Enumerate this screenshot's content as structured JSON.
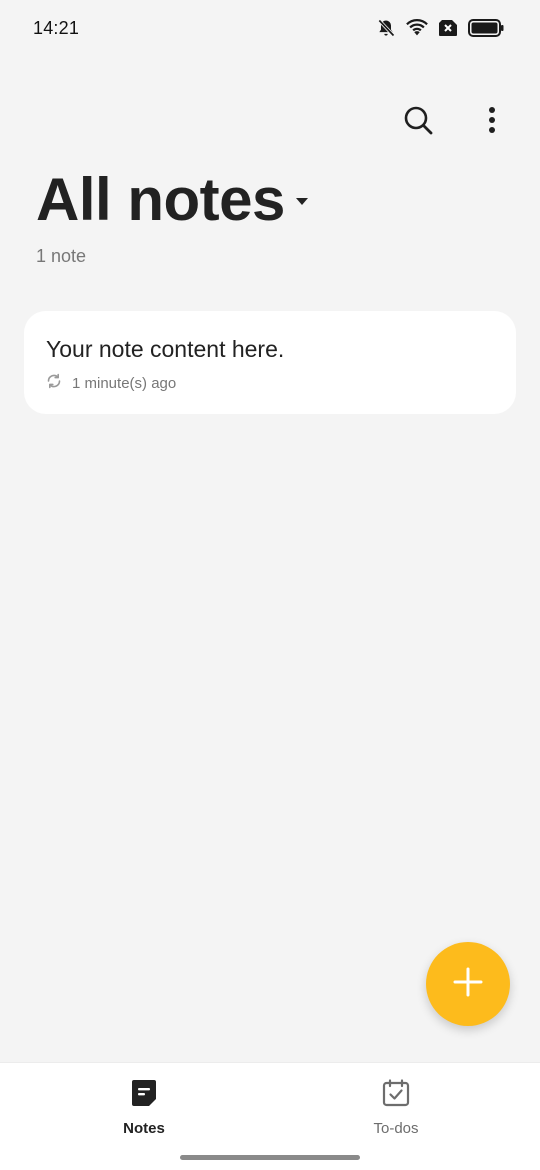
{
  "status_bar": {
    "time": "14:21",
    "icons": [
      "bell-muted-icon",
      "wifi-icon",
      "no-sim-icon",
      "battery-icon"
    ]
  },
  "toolbar": {
    "icons": [
      "search-icon",
      "more-vertical-icon"
    ]
  },
  "header": {
    "title": "All notes",
    "count": "1 note"
  },
  "notes": [
    {
      "title": "Your note content here.",
      "time": "1 minute(s) ago",
      "sync_icon": "sync-icon"
    }
  ],
  "fab": {
    "icon": "plus-icon",
    "color": "#fdbb1c"
  },
  "bottom_nav": {
    "items": [
      {
        "label": "Notes",
        "icon": "note-icon",
        "active": true
      },
      {
        "label": "To-dos",
        "icon": "todo-calendar-icon",
        "active": false
      }
    ]
  },
  "colors": {
    "background": "#f4f4f4",
    "card": "#ffffff",
    "accent": "#fdbb1c"
  }
}
